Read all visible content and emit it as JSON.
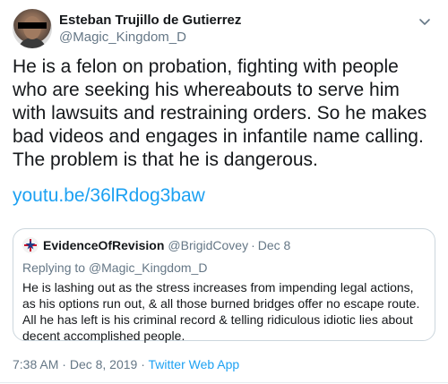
{
  "author": {
    "display_name": "Esteban Trujillo de Gutierrez",
    "handle": "@Magic_Kingdom_D"
  },
  "tweet": {
    "text": "He is a felon on probation, fighting with people who are seeking his whereabouts to serve him with lawsuits and restraining orders. So he makes bad videos and engages in infantile name calling. The problem is that he is dangerous.",
    "link": "youtu.be/36lRdog3baw"
  },
  "quoted_tweet": {
    "display_name": "EvidenceOfRevision",
    "handle": "@BrigidCovey",
    "separator": "·",
    "date": "Dec 8",
    "replying_prefix": "Replying to ",
    "replying_to": "@Magic_Kingdom_D",
    "text": "He is lashing out as the stress increases from impending legal actions, as his options run out, & all those burned bridges offer no escape route. All he has left is his criminal record & telling ridiculous idiotic lies about decent accomplished people."
  },
  "meta": {
    "time": "7:38 AM",
    "separator": "·",
    "date": "Dec 8, 2019",
    "source": "Twitter Web App"
  },
  "colors": {
    "link": "#1da1f2",
    "secondary_text": "#657786",
    "primary_text": "#14171a",
    "border": "#ccd6dd"
  },
  "icons": {
    "menu": "chevron-down-icon",
    "quoted_avatar": "star-flag-avatar"
  }
}
